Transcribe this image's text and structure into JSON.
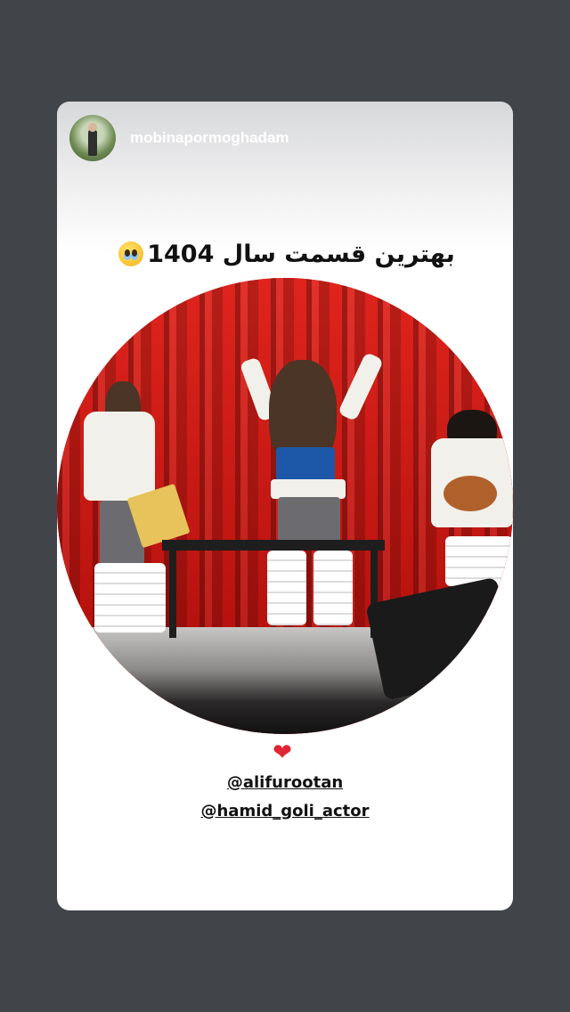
{
  "story": {
    "username": "mobinapormoghadam",
    "caption": "بهترین قسمت سال 1404",
    "caption_emoji": "pleading-face-emoji",
    "heart": "❤",
    "mentions": [
      "@alifurootan",
      "@hamid_goli_actor"
    ]
  },
  "colors": {
    "background": "#414449",
    "card": "#ffffff",
    "curtain": "#d41b17",
    "heart": "#e02632"
  }
}
